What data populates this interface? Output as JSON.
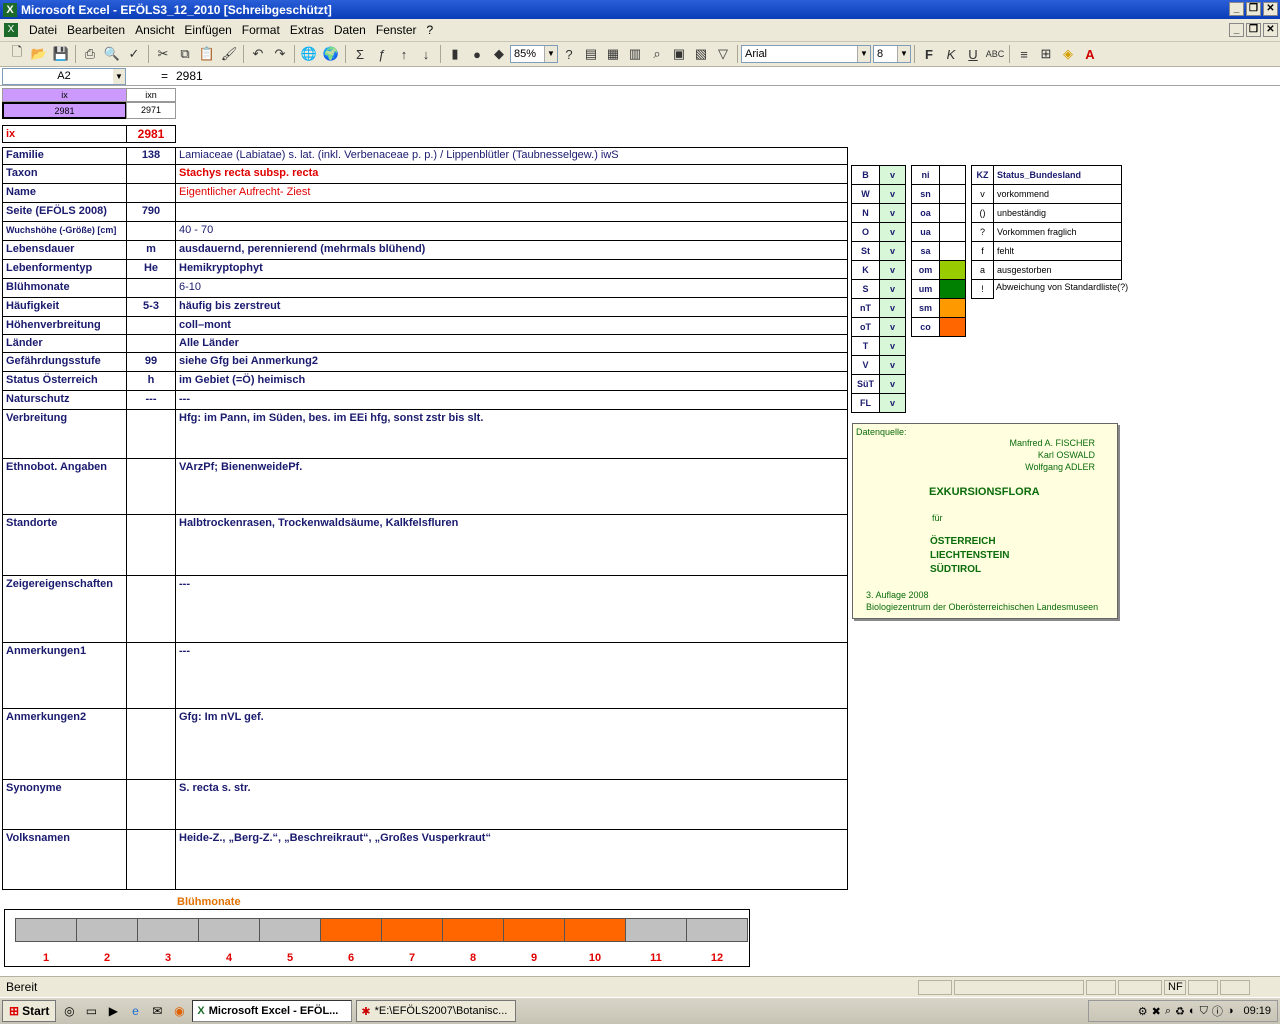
{
  "window": {
    "title": "Microsoft Excel - EFÖLS3_12_2010  [Schreibgeschützt]"
  },
  "menu": [
    "Datei",
    "Bearbeiten",
    "Ansicht",
    "Einfügen",
    "Format",
    "Extras",
    "Daten",
    "Fenster",
    "?"
  ],
  "toolbar": {
    "zoom": "85%",
    "font": "Arial",
    "size": "8"
  },
  "formula": {
    "cell_ref": "A2",
    "eq": "=",
    "value": "2981"
  },
  "sheet": {
    "ix_header": "ix",
    "ixn_header": "ixn",
    "ix_val": "2981",
    "ixn_val": "2971",
    "ix_label": "ix",
    "ix_big": "2981",
    "rows": [
      {
        "label": "Familie",
        "code": "138",
        "value": "Lamiaceae (Labiatae) s. lat. (inkl. Verbenaceae p. p.)  /  Lippenblütler (Taubnesselgew.) iwS"
      },
      {
        "label": "Taxon",
        "code": "",
        "value": "Stachys recta subsp. recta"
      },
      {
        "label": "Name",
        "code": "",
        "value": "Eigentlicher Aufrecht- Ziest"
      },
      {
        "label": "Seite (EFÖLS 2008)",
        "code": "790",
        "value": ""
      },
      {
        "label": "Wuchshöhe (-Größe) [cm]",
        "code": "",
        "value": " 40 - 70"
      },
      {
        "label": "Lebensdauer",
        "code": "m",
        "value": "ausdauernd, perennierend (mehrmals blühend)"
      },
      {
        "label": "Lebenformentyp",
        "code": "He",
        "value": "Hemikryptophyt"
      },
      {
        "label": "Blühmonate",
        "code": "",
        "value": " 6-10"
      },
      {
        "label": "Häufigkeit",
        "code": "5-3",
        "value": "häufig bis zerstreut"
      },
      {
        "label": "Höhenverbreitung",
        "code": "",
        "value": "coll–mont"
      },
      {
        "label": "Länder",
        "code": "",
        "value": "Alle Länder"
      },
      {
        "label": "Gefährdungsstufe",
        "code": "99",
        "value": "siehe Gfg bei Anmerkung2"
      },
      {
        "label": "Status Österreich",
        "code": "h",
        "value": "im Gebiet (=Ö) heimisch"
      },
      {
        "label": "Naturschutz",
        "code": "---",
        "value": "---"
      },
      {
        "label": "Verbreitung",
        "code": "",
        "value": "Hfg: im Pann, im Süden, bes. im EEi hfg, sonst zstr bis slt."
      },
      {
        "label": "Ethnobot. Angaben",
        "code": "",
        "value": "VArzPf; BienenweidePf."
      },
      {
        "label": "Standorte",
        "code": "",
        "value": "Halbtrockenrasen, Trockenwaldsäume, Kalkfelsfluren"
      },
      {
        "label": "Zeigereigenschaften",
        "code": "",
        "value": "---"
      },
      {
        "label": "Anmerkungen1",
        "code": "",
        "value": "---"
      },
      {
        "label": "Anmerkungen2",
        "code": "",
        "value": "Gfg: Im nVL gef."
      },
      {
        "label": "Synonyme",
        "code": "",
        "value": "S. recta s. str."
      },
      {
        "label": "Volksnamen",
        "code": "",
        "value": "Heide-Z.,  „Berg-Z.“, „Beschreikraut“, „Großes Vusperkraut“"
      }
    ],
    "regions": [
      {
        "k": "B",
        "v": "v"
      },
      {
        "k": "W",
        "v": "v"
      },
      {
        "k": "N",
        "v": "v"
      },
      {
        "k": "O",
        "v": "v"
      },
      {
        "k": "St",
        "v": "v"
      },
      {
        "k": "K",
        "v": "v"
      },
      {
        "k": "S",
        "v": "v"
      },
      {
        "k": "nT",
        "v": "v"
      },
      {
        "k": "oT",
        "v": "v"
      },
      {
        "k": "T",
        "v": "v"
      },
      {
        "k": "V",
        "v": "v"
      },
      {
        "k": "SüT",
        "v": "v"
      },
      {
        "k": "FL",
        "v": "v"
      }
    ],
    "altitudes": [
      {
        "k": "ni",
        "color": "#ffffff"
      },
      {
        "k": "sn",
        "color": "#ffffff"
      },
      {
        "k": "oa",
        "color": "#ffffff"
      },
      {
        "k": "ua",
        "color": "#ffffff"
      },
      {
        "k": "sa",
        "color": "#ffffff"
      },
      {
        "k": "om",
        "color": "#99cc00"
      },
      {
        "k": "um",
        "color": "#008000"
      },
      {
        "k": "sm",
        "color": "#ff9900"
      },
      {
        "k": "co",
        "color": "#ff6600"
      }
    ],
    "status_legend": {
      "kz": "KZ",
      "title": "Status_Bundesland",
      "items": [
        {
          "k": "v",
          "t": "vorkommend"
        },
        {
          "k": "()",
          "t": "unbeständig"
        },
        {
          "k": "?",
          "t": "Vorkommen fraglich"
        },
        {
          "k": "f",
          "t": "fehlt"
        },
        {
          "k": "a",
          "t": "ausgestorben"
        },
        {
          "k": "!",
          "t": "Abweichung von Standardliste(?)"
        }
      ]
    },
    "datenquelle": {
      "label": "Datenquelle:",
      "a1": "Manfred A. FISCHER",
      "a2": "Karl OSWALD",
      "a3": "Wolfgang ADLER",
      "title": "EXKURSIONSFLORA",
      "fuer": "für",
      "c1": "ÖSTERREICH",
      "c2": "LIECHTENSTEIN",
      "c3": "SÜDTIROL",
      "ed": "3. Auflage 2008",
      "pub": "Biologiezentrum der Oberösterreichischen Landesmuseen"
    },
    "bluehmonate_title": "Blühmonate",
    "months": [
      "1",
      "2",
      "3",
      "4",
      "5",
      "6",
      "7",
      "8",
      "9",
      "10",
      "11",
      "12"
    ],
    "flowering": [
      false,
      false,
      false,
      false,
      false,
      true,
      true,
      true,
      true,
      true,
      false,
      false
    ],
    "bar_on_color": "#ff6600",
    "bar_off_color": "#c0c0c0"
  },
  "status": {
    "text": "Bereit",
    "nf": "NF"
  },
  "taskbar": {
    "start": "Start",
    "task1": "Microsoft Excel - EFÖL...",
    "task2": "*E:\\EFÖLS2007\\Botanisc...",
    "clock": "09:19"
  }
}
